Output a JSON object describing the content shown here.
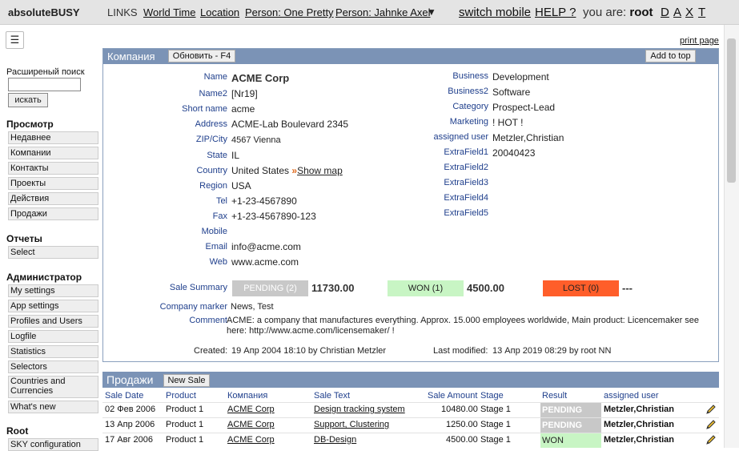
{
  "app": {
    "title": "absoluteBUSY"
  },
  "topbar": {
    "links_label": "LINKS",
    "links": [
      "World Time",
      "Location",
      "Person: One Pretty",
      "Person: Jahnke Axel"
    ],
    "dropdown_arrow": "▼",
    "switch_mobile": "switch mobile",
    "help": "HELP ?",
    "you_are_label": "you are:",
    "user": "root",
    "letters": [
      "D",
      "A",
      "X",
      "T"
    ]
  },
  "sidebar": {
    "menu_icon": "☰",
    "advanced_search_label": "Расширеный поиск",
    "search_button": "искать",
    "sections": [
      {
        "title": "Просмотр",
        "items": [
          "Недавнее",
          "Компании",
          "Контакты",
          "Проекты",
          "Действия",
          "Продажи"
        ]
      },
      {
        "title": "Отчеты",
        "items": [
          "Select"
        ]
      },
      {
        "title": "Администратор",
        "items": [
          "My settings",
          "App settings",
          "Profiles and Users",
          "Logfile",
          "Statistics",
          "Selectors",
          "Countries and Currencies",
          "What's new"
        ]
      },
      {
        "title": "Root",
        "items": [
          "SKY configuration"
        ]
      }
    ]
  },
  "print_page": "print page",
  "company_panel": {
    "title": "Компания",
    "refresh_button": "Обновить - F4",
    "add_to_top_button": "Add to top",
    "left_fields": [
      {
        "label": "Name",
        "value": "ACME Corp"
      },
      {
        "label": "Name2",
        "value": "[Nr19]"
      },
      {
        "label": "Short name",
        "value": "acme"
      },
      {
        "label": "Address",
        "value": "ACME-Lab Boulevard 2345"
      },
      {
        "label": "ZIP/City",
        "value": "4567 Vienna"
      },
      {
        "label": "State",
        "value": "IL"
      },
      {
        "label": "Country",
        "value": "United States"
      },
      {
        "label": "Region",
        "value": "USA"
      },
      {
        "label": "Tel",
        "value": "+1-23-4567890"
      },
      {
        "label": "Fax",
        "value": "+1-23-4567890-123"
      },
      {
        "label": "Mobile",
        "value": ""
      },
      {
        "label": "Email",
        "value": "info@acme.com"
      },
      {
        "label": "Web",
        "value": "www.acme.com"
      }
    ],
    "show_map": "Show map",
    "country_arrow": "»",
    "right_fields": [
      {
        "label": "Business",
        "value": "Development"
      },
      {
        "label": "Business2",
        "value": "Software"
      },
      {
        "label": "Category",
        "value": "Prospect-Lead"
      },
      {
        "label": "Marketing",
        "value": "! HOT !"
      },
      {
        "label": "assigned user",
        "value": "Metzler,Christian"
      },
      {
        "label": "ExtraField1",
        "value": "20040423"
      },
      {
        "label": "ExtraField2",
        "value": ""
      },
      {
        "label": "ExtraField3",
        "value": ""
      },
      {
        "label": "ExtraField4",
        "value": ""
      },
      {
        "label": "ExtraField5",
        "value": ""
      }
    ],
    "sale_summary": {
      "label": "Sale Summary",
      "pending_label": "PENDING (2)",
      "pending_value": "11730.00",
      "won_label": "WON (1)",
      "won_value": "4500.00",
      "lost_label": "LOST (0)",
      "lost_value": "---"
    },
    "company_marker_label": "Company marker",
    "company_marker_value": "News, Test",
    "comment_label": "Comment",
    "comment_value": "ACME: a company that manufactures everything. Approx. 15.000 employees worldwide, Main product: Licencemaker see here: http://www.acme.com/licensemaker/ !",
    "created_label": "Created:",
    "created_value": "19 Апр 2004 18:10 by Christian Metzler",
    "modified_label": "Last modified:",
    "modified_value": "13 Апр 2019 08:29 by root NN"
  },
  "sales_panel": {
    "title": "Продажи",
    "new_sale_button": "New Sale",
    "columns": [
      "Sale Date",
      "Product",
      "Компания",
      "Sale Text",
      "Sale Amount",
      "Stage",
      "Result",
      "assigned user"
    ],
    "rows": [
      {
        "date": "02 Фев 2006",
        "product": "Product 1",
        "company": "ACME Corp",
        "text": "Design tracking system",
        "amount": "10480.00",
        "stage": "Stage 1",
        "result": "PENDING",
        "user": "Metzler,Christian"
      },
      {
        "date": "13 Апр 2006",
        "product": "Product 1",
        "company": "ACME Corp",
        "text": "Support, Clustering",
        "amount": "1250.00",
        "stage": "Stage 1",
        "result": "PENDING",
        "user": "Metzler,Christian"
      },
      {
        "date": "17 Авг 2006",
        "product": "Product 1",
        "company": "ACME Corp",
        "text": "DB-Design",
        "amount": "4500.00",
        "stage": "Stage 1",
        "result": "WON",
        "user": "Metzler,Christian"
      }
    ]
  },
  "colors": {
    "header_blue": "#7b93b6",
    "label_blue": "#1f3f8c",
    "pending": "#c8c8c8",
    "won": "#c8f5c4",
    "lost": "#ff5e2a"
  }
}
